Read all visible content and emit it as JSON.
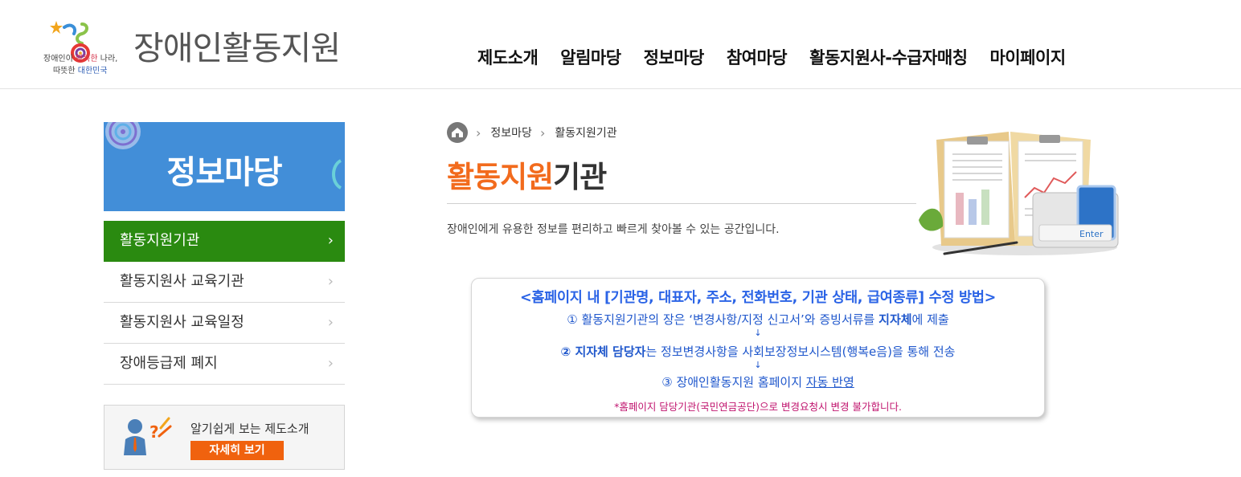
{
  "header": {
    "logo_title": "장애인활동지원",
    "slogan_line1_a": "장애인이 ",
    "slogan_line1_b": "행복한",
    "slogan_line1_c": " 나라,",
    "slogan_line2_a": "따뜻한 ",
    "slogan_line2_b": "대한민국",
    "nav": [
      "제도소개",
      "알림마당",
      "정보마당",
      "참여마당",
      "활동지원사-수급자매칭",
      "마이페이지"
    ]
  },
  "sidebar": {
    "banner_title": "정보마당",
    "items": [
      {
        "label": "활동지원기관",
        "active": true
      },
      {
        "label": "활동지원사 교육기관",
        "active": false
      },
      {
        "label": "활동지원사 교육일정",
        "active": false
      },
      {
        "label": "장애등급제 폐지",
        "active": false
      }
    ],
    "info_text": "알기쉽게 보는 제도소개",
    "info_button": "자세히 보기"
  },
  "breadcrumb": [
    "정보마당",
    "활동지원기관"
  ],
  "page": {
    "title_accent": "활동지원",
    "title_rest": "기관",
    "description": "장애인에게 유용한 정보를 편리하고 빠르게 찾아볼 수 있는 공간입니다.",
    "enter_label": "Enter"
  },
  "notice": {
    "heading": "<홈페이지 내 [기관명, 대표자, 주소, 전화번호, 기관 상태, 급여종류] 수정 방법>",
    "step1_a": "① 활동지원기관의 장은 ‘변경사항/지정 신고서’와 증빙서류를 ",
    "step1_b": "지자체",
    "step1_c": "에 제출",
    "step2_a": "② 지자체 담당자",
    "step2_b": "는 정보변경사항을 사회보장정보시스템(행복e음)을 통해 전송",
    "step3_a": "③ 장애인활동지원 홈페이지 ",
    "step3_b": "자동 반영",
    "note": "*홈페이지 담당기관(국민연금공단)으로 변경요청시 변경 불가합니다.",
    "arrow": "↓"
  },
  "colors": {
    "banner_bg": "#428ed8",
    "active_menu": "#2a8a10",
    "accent_orange": "#f26b1d",
    "button_orange": "#f0620e",
    "notice_blue": "#2a63e6",
    "notice_magenta": "#c0146e"
  }
}
